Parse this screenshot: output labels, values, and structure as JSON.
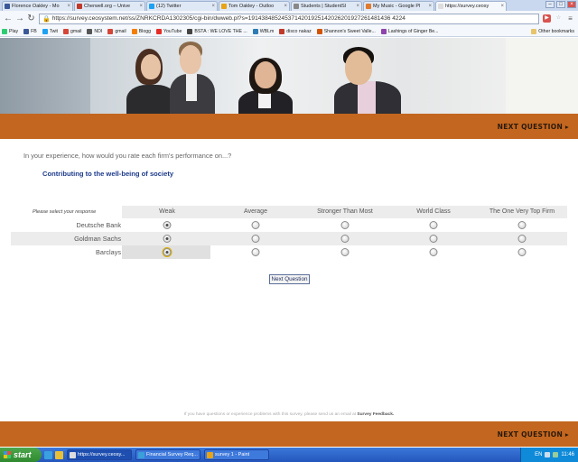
{
  "browser": {
    "tabs": [
      {
        "label": "Florence Oakley - Mo",
        "color": "#3b5998",
        "active": false
      },
      {
        "label": "Cherwell.org – Unive",
        "color": "#c0392b",
        "active": false
      },
      {
        "label": "(12) Twitter",
        "color": "#1da1f2",
        "active": false
      },
      {
        "label": "Tom Oakley - Outloo",
        "color": "#e8a317",
        "active": false
      },
      {
        "label": "Students | StudentSl",
        "color": "#888888",
        "active": false
      },
      {
        "label": "My Music - Google Pl",
        "color": "#e07a2f",
        "active": false
      },
      {
        "label": "https://survey.ceosy",
        "color": "#dddddd",
        "active": true
      }
    ],
    "url": "https://survey.ceosystem.net/ss/ZNRKCRDA1302305/cgi-bin/dwweb.pl?s=1914384852453714201925142026201927261481436 4224",
    "bookmarks": [
      {
        "label": "Play",
        "color": "#2ecc71"
      },
      {
        "label": "FB",
        "color": "#3b5998"
      },
      {
        "label": "Twit",
        "color": "#1da1f2"
      },
      {
        "label": "gmail",
        "color": "#d44638"
      },
      {
        "label": "NDI",
        "color": "#555555"
      },
      {
        "label": "gmail",
        "color": "#d44638"
      },
      {
        "label": "Blogg",
        "color": "#f57d00"
      },
      {
        "label": "YouTube",
        "color": "#e52d27"
      },
      {
        "label": "BSTA : WE LOVE THE ...",
        "color": "#444444"
      },
      {
        "label": "WBLm",
        "color": "#2d7bb5"
      },
      {
        "label": "disco nakaz",
        "color": "#c0392b"
      },
      {
        "label": "Shannon's Sweet Valle...",
        "color": "#d35400"
      },
      {
        "label": "Lashings of Ginger Be...",
        "color": "#8e44ad"
      }
    ],
    "other_bookmarks": "Other bookmarks"
  },
  "survey": {
    "next_question_label": "NEXT QUESTION ▸",
    "question": "In your experience, how would you rate each firm's performance on...?",
    "subheading": "Contributing to the well-being of society",
    "prompt": "Please select your response",
    "columns": [
      "Weak",
      "Average",
      "Stronger Than Most",
      "World Class",
      "The One Very Top Firm"
    ],
    "rows": [
      {
        "label": "Deutsche Bank",
        "selected": 0
      },
      {
        "label": "Goldman Sachs",
        "selected": 0
      },
      {
        "label": "Barclays",
        "selected": 0
      }
    ],
    "next_button": "Next Question",
    "footer_text": "If you have questions or experience problems with this survey, please send us an email at",
    "footer_link": "Survey Feedback."
  },
  "taskbar": {
    "start_label": "start",
    "tasks": [
      {
        "label": "https://survey.ceosy...",
        "color": "#dddddd",
        "active": true
      },
      {
        "label": "Financial Survey Req...",
        "color": "#3b9fd8",
        "active": false
      },
      {
        "label": "survey 1 - Paint",
        "color": "#e8a317",
        "active": false
      }
    ],
    "lang": "EN",
    "clock": "11:46"
  }
}
